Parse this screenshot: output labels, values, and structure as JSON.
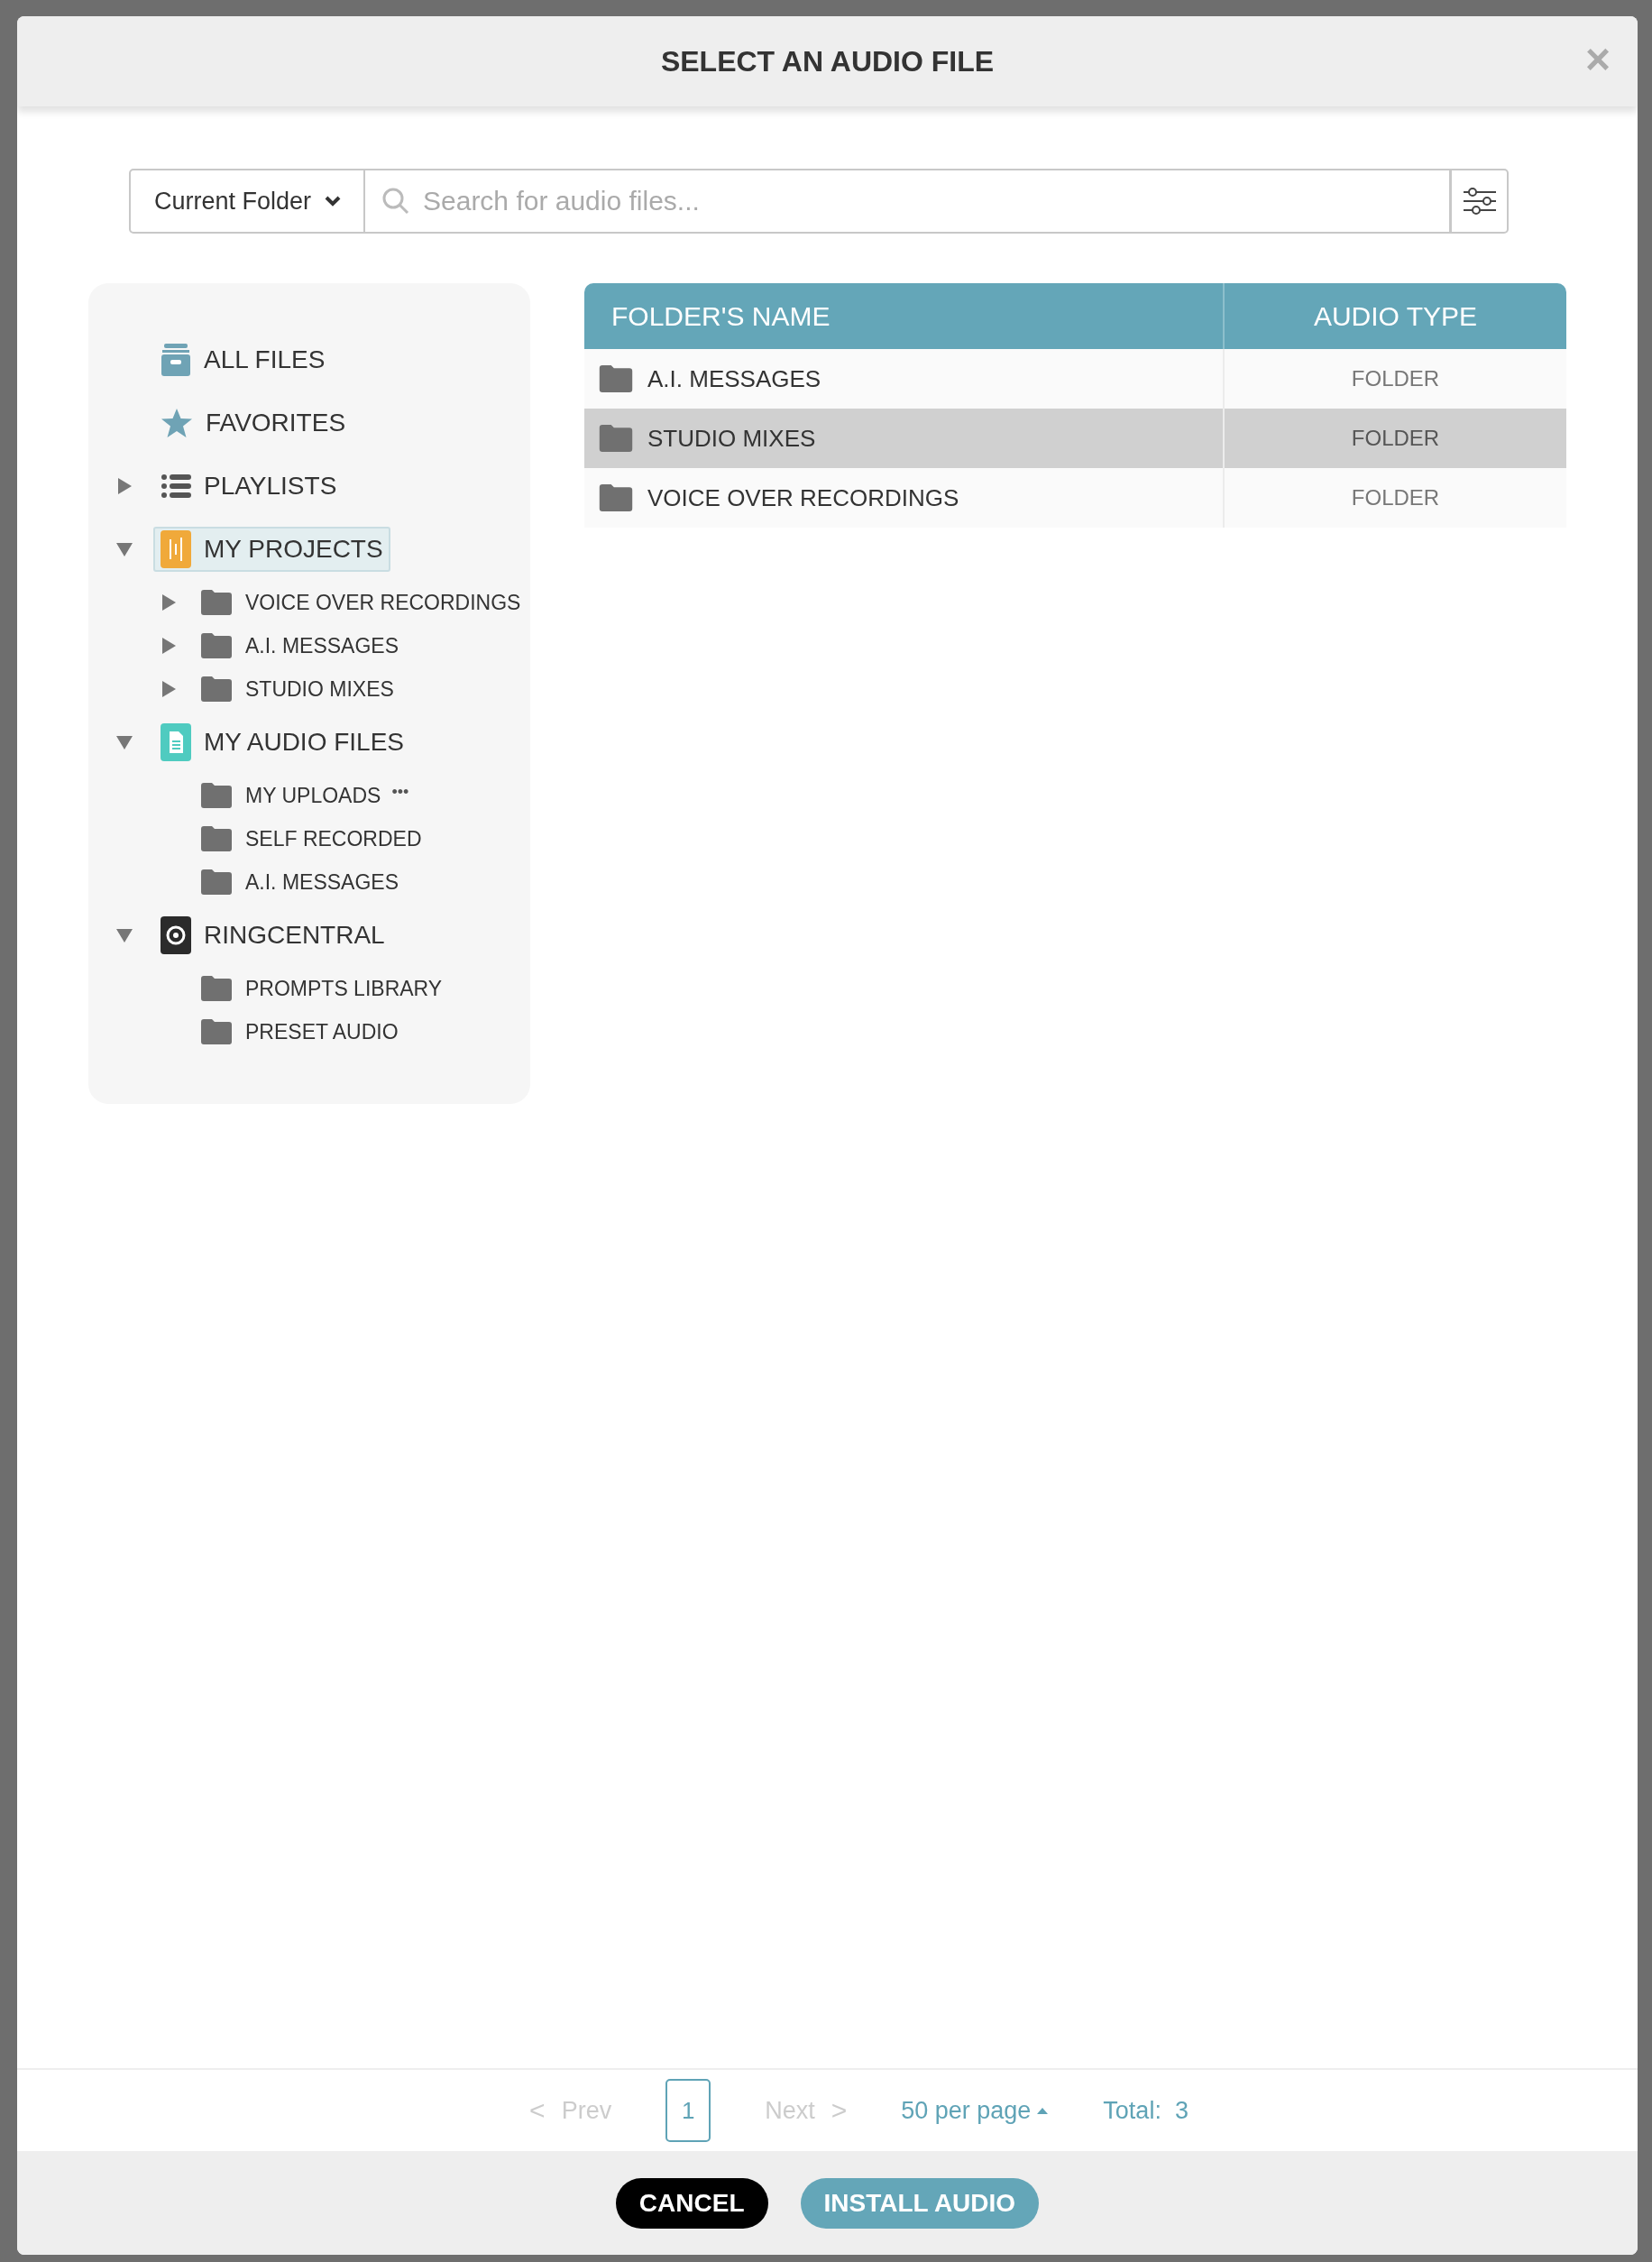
{
  "dialog": {
    "title": "SELECT AN AUDIO FILE",
    "close": "×"
  },
  "search": {
    "scope": "Current Folder",
    "placeholder": "Search for audio files..."
  },
  "sidebar": {
    "items": [
      {
        "label": "ALL FILES",
        "kind": "archive",
        "selected": false
      },
      {
        "label": "FAVORITES",
        "kind": "star",
        "selected": false
      },
      {
        "label": "PLAYLISTS",
        "kind": "list",
        "selected": false,
        "expanded": false
      },
      {
        "label": "MY PROJECTS",
        "kind": "waveform",
        "selected": true,
        "expanded": true,
        "children": [
          {
            "label": "VOICE OVER RECORDINGS",
            "expanded": false
          },
          {
            "label": "A.I. MESSAGES",
            "expanded": false
          },
          {
            "label": "STUDIO MIXES",
            "expanded": false
          }
        ]
      },
      {
        "label": "MY AUDIO FILES",
        "kind": "document",
        "selected": false,
        "expanded": true,
        "children": [
          {
            "label": "MY UPLOADS",
            "more": "•••"
          },
          {
            "label": "SELF RECORDED"
          },
          {
            "label": "A.I. MESSAGES"
          }
        ]
      },
      {
        "label": "RINGCENTRAL",
        "kind": "disc",
        "selected": false,
        "expanded": true,
        "children": [
          {
            "label": "PROMPTS LIBRARY"
          },
          {
            "label": "PRESET AUDIO"
          }
        ]
      }
    ]
  },
  "table": {
    "columns": [
      "FOLDER'S NAME",
      "AUDIO TYPE"
    ],
    "rows": [
      {
        "name": "A.I. MESSAGES",
        "type": "FOLDER",
        "selected": false
      },
      {
        "name": "STUDIO MIXES",
        "type": "FOLDER",
        "selected": true
      },
      {
        "name": "VOICE OVER RECORDINGS",
        "type": "FOLDER",
        "selected": false
      }
    ]
  },
  "pagination": {
    "prev": {
      "icon": "<",
      "label": "Prev",
      "disabled": true
    },
    "page": "1",
    "next": {
      "label": "Next",
      "icon": ">",
      "disabled": true
    },
    "per_page": "50 per page",
    "total": "Total:  3"
  },
  "buttons": [
    {
      "label": "CANCEL",
      "kind": "secondary"
    },
    {
      "label": "INSTALL AUDIO",
      "kind": "primary"
    }
  ]
}
